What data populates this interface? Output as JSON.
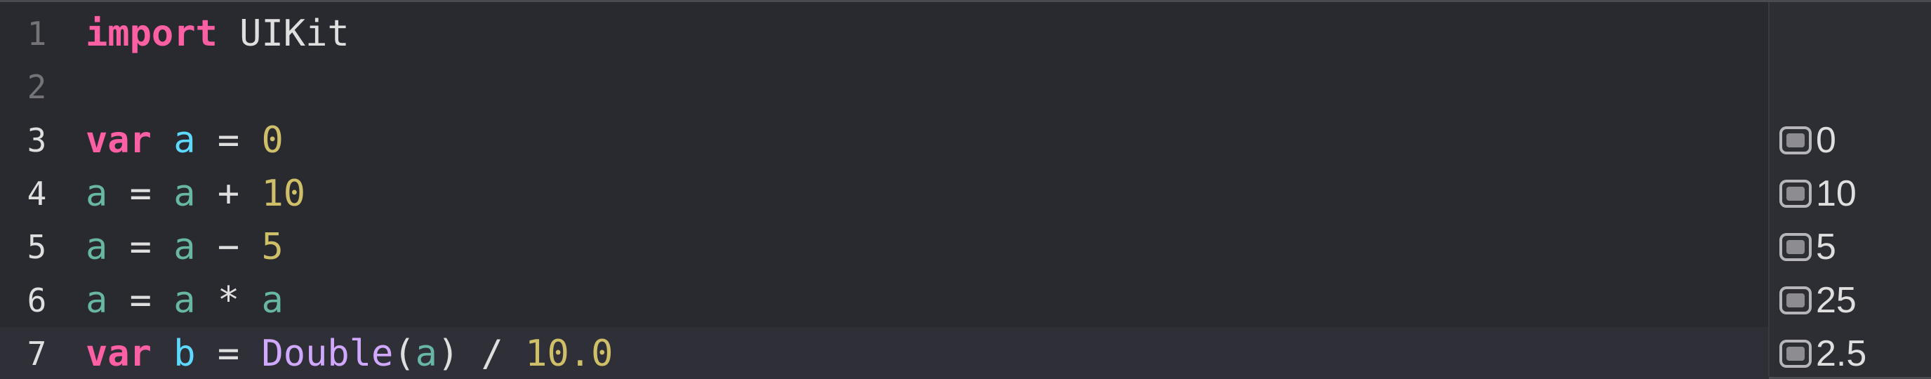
{
  "editor": {
    "lines": [
      {
        "number": "1",
        "tokens": [
          {
            "text": "import",
            "kind": "kw"
          },
          {
            "text": " UIKit",
            "kind": "plain"
          }
        ]
      },
      {
        "number": "2",
        "tokens": []
      },
      {
        "number": "3",
        "tokens": [
          {
            "text": "var",
            "kind": "kw"
          },
          {
            "text": " ",
            "kind": "plain"
          },
          {
            "text": "a",
            "kind": "decl"
          },
          {
            "text": " = ",
            "kind": "plain"
          },
          {
            "text": "0",
            "kind": "num"
          }
        ]
      },
      {
        "number": "4",
        "tokens": [
          {
            "text": "a",
            "kind": "var"
          },
          {
            "text": " = ",
            "kind": "plain"
          },
          {
            "text": "a",
            "kind": "var"
          },
          {
            "text": " + ",
            "kind": "plain"
          },
          {
            "text": "10",
            "kind": "num"
          }
        ]
      },
      {
        "number": "5",
        "tokens": [
          {
            "text": "a",
            "kind": "var"
          },
          {
            "text": " = ",
            "kind": "plain"
          },
          {
            "text": "a",
            "kind": "var"
          },
          {
            "text": " − ",
            "kind": "plain"
          },
          {
            "text": "5",
            "kind": "num"
          }
        ]
      },
      {
        "number": "6",
        "tokens": [
          {
            "text": "a",
            "kind": "var"
          },
          {
            "text": " = ",
            "kind": "plain"
          },
          {
            "text": "a",
            "kind": "var"
          },
          {
            "text": " * ",
            "kind": "plain"
          },
          {
            "text": "a",
            "kind": "var"
          }
        ]
      },
      {
        "number": "7",
        "tokens": [
          {
            "text": "var",
            "kind": "kw"
          },
          {
            "text": " ",
            "kind": "plain"
          },
          {
            "text": "b",
            "kind": "decl"
          },
          {
            "text": " = ",
            "kind": "plain"
          },
          {
            "text": "Double",
            "kind": "type"
          },
          {
            "text": "(",
            "kind": "plain"
          },
          {
            "text": "a",
            "kind": "var"
          },
          {
            "text": ") / ",
            "kind": "plain"
          },
          {
            "text": "10.0",
            "kind": "num"
          }
        ]
      }
    ],
    "current_line": "7"
  },
  "results": [
    {
      "line": "3",
      "value": "0"
    },
    {
      "line": "4",
      "value": "10"
    },
    {
      "line": "5",
      "value": "5"
    },
    {
      "line": "6",
      "value": "25"
    },
    {
      "line": "7",
      "value": "2.5"
    }
  ],
  "colors": {
    "background": "#292a30",
    "keyword": "#fc5fa3",
    "declaration": "#5dd8ff",
    "variable": "#67b7a4",
    "number": "#d0bf69",
    "type": "#d0a8ff",
    "plain": "#dfdfe0"
  },
  "icons": {
    "result": "quick-look-result-icon"
  }
}
